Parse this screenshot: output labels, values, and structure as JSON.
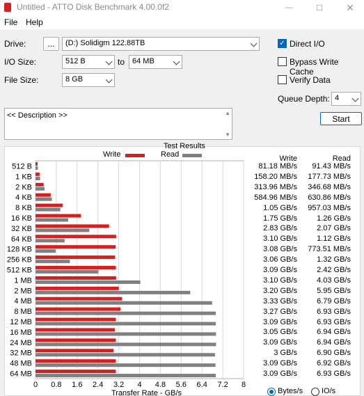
{
  "window": {
    "title": "Untitled - ATTO Disk Benchmark 4.00.0f2",
    "minimize_icon": "minimize-icon",
    "maximize_icon": "maximize-icon",
    "close_icon": "close-icon"
  },
  "menu": {
    "file": "File",
    "help": "Help"
  },
  "controls": {
    "drive_label": "Drive:",
    "browse_label": "...",
    "drive_value": "(D:) Solidigm 122.88TB",
    "io_size_label": "I/O Size:",
    "io_from": "512 B",
    "io_to_label": "to",
    "io_to": "64 MB",
    "file_size_label": "File Size:",
    "file_size": "8 GB",
    "direct_io_label": "Direct I/O",
    "direct_io": true,
    "bypass_write_cache_label": "Bypass Write Cache",
    "bypass_write_cache": false,
    "verify_data_label": "Verify Data",
    "verify_data": false,
    "queue_depth_label": "Queue Depth:",
    "queue_depth": "4",
    "start_label": "Start",
    "description_text": "<< Description >>"
  },
  "results": {
    "title": "Test Results",
    "write_col": "Write",
    "read_col": "Read",
    "bytes_label": "Bytes/s",
    "io_label": "IO/s",
    "unit_selected": "Bytes/s"
  },
  "chart_data": {
    "type": "bar",
    "orientation": "horizontal",
    "title": "Test Results",
    "xlabel": "Transfer Rate - GB/s",
    "xlim": [
      0,
      8
    ],
    "xticks": [
      "0",
      "0.8",
      "1.6",
      "2.4",
      "3.2",
      "4",
      "4.8",
      "5.6",
      "6.4",
      "7.2",
      "8"
    ],
    "grid": true,
    "legend": "top",
    "colors": {
      "write": "#d42020",
      "read": "#808080"
    },
    "categories": [
      "512 B",
      "1 KB",
      "2 KB",
      "4 KB",
      "8 KB",
      "16 KB",
      "32 KB",
      "64 KB",
      "128 KB",
      "256 KB",
      "512 KB",
      "1 MB",
      "2 MB",
      "4 MB",
      "8 MB",
      "12 MB",
      "16 MB",
      "24 MB",
      "32 MB",
      "48 MB",
      "64 MB"
    ],
    "series": [
      {
        "name": "Write",
        "values": [
          0.081,
          0.158,
          0.314,
          0.585,
          1.05,
          1.75,
          2.83,
          3.1,
          3.08,
          3.06,
          3.09,
          3.1,
          3.2,
          3.33,
          3.27,
          3.09,
          3.05,
          3.09,
          3.0,
          3.09,
          3.09
        ],
        "labels": [
          "81.18 MB/s",
          "158.20 MB/s",
          "313.96 MB/s",
          "584.96 MB/s",
          "1.05 GB/s",
          "1.75 GB/s",
          "2.83 GB/s",
          "3.10 GB/s",
          "3.08 GB/s",
          "3.06 GB/s",
          "3.09 GB/s",
          "3.10 GB/s",
          "3.20 GB/s",
          "3.33 GB/s",
          "3.27 GB/s",
          "3.09 GB/s",
          "3.05 GB/s",
          "3.09 GB/s",
          "3 GB/s",
          "3.09 GB/s",
          "3.09 GB/s"
        ]
      },
      {
        "name": "Read",
        "values": [
          0.091,
          0.178,
          0.347,
          0.631,
          0.957,
          1.26,
          2.07,
          1.12,
          0.774,
          1.32,
          2.42,
          4.03,
          5.95,
          6.79,
          6.93,
          6.93,
          6.94,
          6.94,
          6.9,
          6.92,
          6.93
        ],
        "labels": [
          "91.43 MB/s",
          "177.73 MB/s",
          "346.68 MB/s",
          "630.86 MB/s",
          "957.03 MB/s",
          "1.26 GB/s",
          "2.07 GB/s",
          "1.12 GB/s",
          "773.51 MB/s",
          "1.32 GB/s",
          "2.42 GB/s",
          "4.03 GB/s",
          "5.95 GB/s",
          "6.79 GB/s",
          "6.93 GB/s",
          "6.93 GB/s",
          "6.94 GB/s",
          "6.94 GB/s",
          "6.90 GB/s",
          "6.92 GB/s",
          "6.93 GB/s"
        ]
      }
    ]
  }
}
